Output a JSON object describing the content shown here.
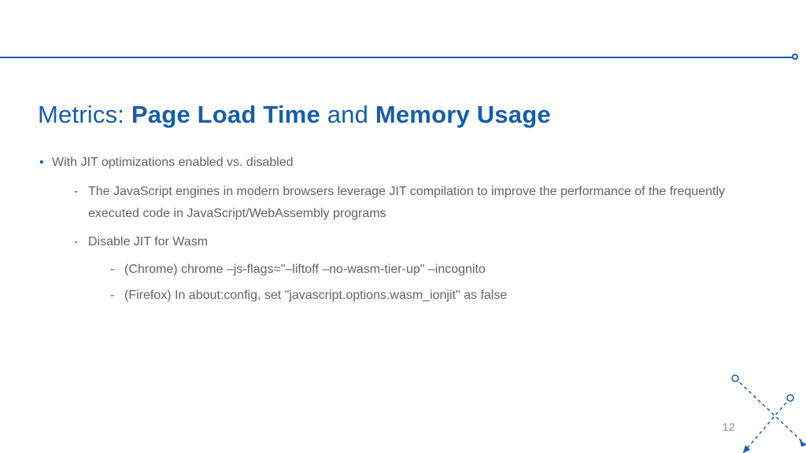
{
  "title": {
    "prefix": "Metrics: ",
    "bold1": "Page Load Time",
    "mid": " and ",
    "bold2": "Memory Usage"
  },
  "bullets": {
    "b1": "With JIT optimizations enabled vs. disabled",
    "b1_1": "The JavaScript engines in modern browsers leverage JIT compilation to improve the performance of the frequently executed code in JavaScript/WebAssembly programs",
    "b1_2": "Disable JIT for Wasm",
    "b1_2_1": "(Chrome) chrome –js-flags=\"–liftoff –no-wasm-tier-up\" –incognito",
    "b1_2_2": "(Firefox) In about:config, set \"javascript.options.wasm_ionjit\" as false"
  },
  "pageNumber": "12",
  "colors": {
    "accent": "#155eab",
    "text": "#606467"
  }
}
